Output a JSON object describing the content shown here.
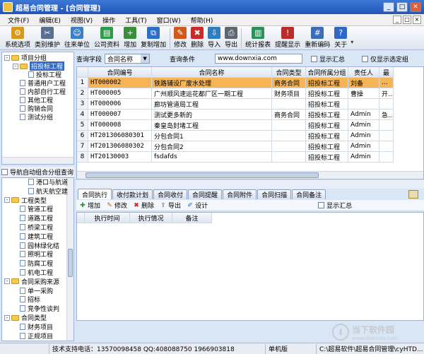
{
  "title": "超易合同管理 - [合同管理]",
  "window_buttons": [
    "_",
    "□",
    "✕"
  ],
  "menu": [
    "文件(F)",
    "编辑(E)",
    "视图(V)",
    "操作",
    "工具(T)",
    "窗口(W)",
    "帮助(H)"
  ],
  "toolbar": [
    {
      "label": "系统选项",
      "icon": "settings-icon",
      "color": "#d79a1b"
    },
    {
      "label": "类别维护",
      "icon": "tools-icon",
      "color": "#5a6f8f"
    },
    {
      "label": "往来单位",
      "icon": "contacts-icon",
      "color": "#3c7fc9"
    },
    {
      "label": "公司资料",
      "icon": "company-icon",
      "color": "#2e9a4a"
    },
    {
      "label": "增加",
      "icon": "add-user-icon",
      "color": "#3a8f3a"
    },
    {
      "label": "复制增加",
      "icon": "copy-icon",
      "color": "#2f6ec7"
    },
    {
      "label": "修改",
      "icon": "edit-icon",
      "color": "#d05a1c"
    },
    {
      "label": "删除",
      "icon": "delete-icon",
      "color": "#cc2a2a"
    },
    {
      "label": "导入",
      "icon": "import-icon",
      "color": "#2e7dbf"
    },
    {
      "label": "导出",
      "icon": "export-icon",
      "color": "#5e6670"
    },
    {
      "label": "统计报表",
      "icon": "report-icon",
      "color": "#2f8f5b"
    },
    {
      "label": "提醒显示",
      "icon": "reminder-icon",
      "color": "#b82c2c"
    },
    {
      "label": "重新编码",
      "icon": "recode-icon",
      "color": "#3c6cb8"
    },
    {
      "label": "关于",
      "icon": "help-icon",
      "color": "#2f67c4"
    }
  ],
  "tree1": [
    {
      "label": "项目分组",
      "level": 0,
      "type": "folder",
      "toggle": "-"
    },
    {
      "label": "招投标工程",
      "level": 1,
      "type": "folder",
      "toggle": "-",
      "selected": true
    },
    {
      "label": "投标工程",
      "level": 2,
      "type": "doc"
    },
    {
      "label": "普通用户工程",
      "level": 1,
      "type": "doc"
    },
    {
      "label": "内部自行工程",
      "level": 1,
      "type": "doc"
    },
    {
      "label": "其他工程",
      "level": 1,
      "type": "doc"
    },
    {
      "label": "购销合同",
      "level": 1,
      "type": "doc"
    },
    {
      "label": "测试分组",
      "level": 1,
      "type": "doc"
    }
  ],
  "query_group_label": "导航自动组合分组查询",
  "tree2": [
    {
      "label": "港口与航道",
      "level": 2,
      "type": "doc"
    },
    {
      "label": "航天航空建",
      "level": 2,
      "type": "doc"
    },
    {
      "label": "工程类型",
      "level": 0,
      "type": "folder",
      "toggle": "-"
    },
    {
      "label": "管道工程",
      "level": 1,
      "type": "doc"
    },
    {
      "label": "道路工程",
      "level": 1,
      "type": "doc"
    },
    {
      "label": "桥梁工程",
      "level": 1,
      "type": "doc"
    },
    {
      "label": "建筑工程",
      "level": 1,
      "type": "doc"
    },
    {
      "label": "园林绿化结",
      "level": 1,
      "type": "doc"
    },
    {
      "label": "照明工程",
      "level": 1,
      "type": "doc"
    },
    {
      "label": "防腐工程",
      "level": 1,
      "type": "doc"
    },
    {
      "label": "机电工程",
      "level": 1,
      "type": "doc"
    },
    {
      "label": "合同采购来源",
      "level": 0,
      "type": "folder",
      "toggle": "-"
    },
    {
      "label": "单一采购",
      "level": 1,
      "type": "doc"
    },
    {
      "label": "招标",
      "level": 1,
      "type": "doc"
    },
    {
      "label": "竞争性谈判",
      "level": 1,
      "type": "doc"
    },
    {
      "label": "合同类型",
      "level": 0,
      "type": "folder",
      "toggle": "-"
    },
    {
      "label": "财务项目",
      "level": 1,
      "type": "doc"
    },
    {
      "label": "正规项目",
      "level": 1,
      "type": "doc"
    }
  ],
  "query": {
    "field_label": "查询字段",
    "field_value": "合同名称",
    "condition_label": "查询条件",
    "condition_value": "www.downxia.com",
    "summary_label": "显示汇总",
    "selected_only_label": "仅显示选定组"
  },
  "grid": {
    "columns": [
      "合同编号",
      "合同名称",
      "合同类型",
      "合同所属分组",
      "责任人",
      "最"
    ],
    "rows": [
      {
        "num": "1",
        "code": "HT000002",
        "name": "铁路铺设厂废水处理",
        "type": "商务合同",
        "group": "招投标工程",
        "owner": "刘备",
        "extra": "..."
      },
      {
        "num": "2",
        "code": "HT000005",
        "name": "广州顺风速运花都厂区一期工程",
        "type": "财务项目",
        "group": "招投标工程",
        "owner": "曹操",
        "extra": "开..."
      },
      {
        "num": "3",
        "code": "HT000006",
        "name": "廊坊管道局工程",
        "type": "",
        "group": "招投标工程",
        "owner": "",
        "extra": ""
      },
      {
        "num": "4",
        "code": "HT000007",
        "name": "测试更多新的",
        "type": "商务合同",
        "group": "招投标工程",
        "owner": "Admin",
        "extra": "急..."
      },
      {
        "num": "5",
        "code": "HT000008",
        "name": "秦皇岛封堵工程",
        "type": "",
        "group": "招投标工程",
        "owner": "Admin",
        "extra": ""
      },
      {
        "num": "6",
        "code": "HT201306080301",
        "name": "分包合同1",
        "type": "",
        "group": "招投标工程",
        "owner": "Admin",
        "extra": ""
      },
      {
        "num": "7",
        "code": "HT201306080302",
        "name": "分包合同2",
        "type": "",
        "group": "招投标工程",
        "owner": "Admin",
        "extra": ""
      },
      {
        "num": "8",
        "code": "HT20130003",
        "name": "fsdafds",
        "type": "",
        "group": "招投标工程",
        "owner": "Admin",
        "extra": ""
      }
    ]
  },
  "tabs": [
    "合同执行",
    "收付款计划",
    "合同收付",
    "合同提醒",
    "合同附件",
    "合同扫描",
    "合同备注"
  ],
  "sub_toolbar": {
    "add": "增加",
    "edit": "修改",
    "delete": "删除",
    "export": "导出",
    "design": "设计",
    "summary": "显示汇总"
  },
  "sub_grid_columns": [
    "执行时间",
    "执行情况",
    "备注"
  ],
  "status": {
    "support": "技术支持电话：13570098458 QQ:408088750 1966903818",
    "mode": "单机版",
    "path": "C:\\超易软件\\超易合同管理\\cyHTD..."
  },
  "watermark": {
    "name": "当下软件园",
    "url": "www.downxia.com"
  }
}
